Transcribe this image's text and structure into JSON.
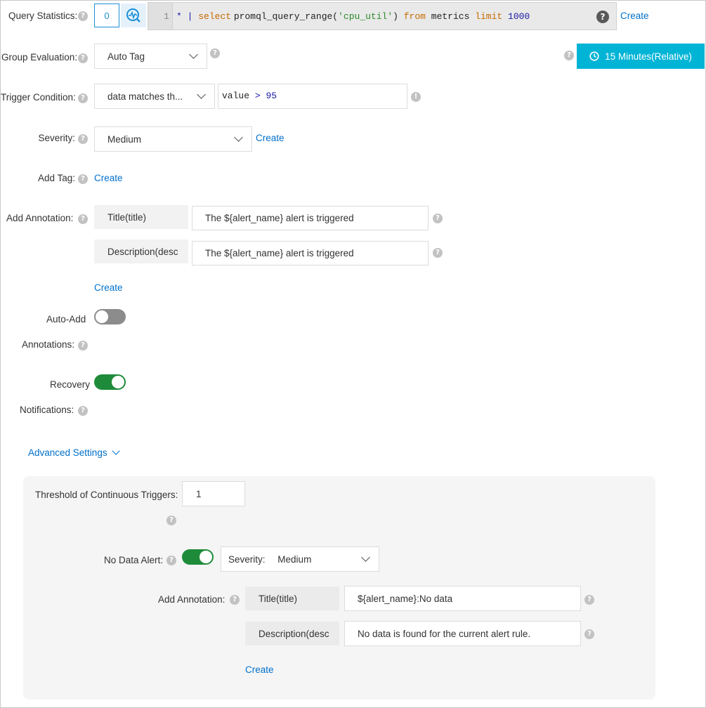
{
  "query": {
    "label": "Query Statistics:",
    "count": "0",
    "line_number": "1",
    "code": {
      "star": "*",
      "pipe": "|",
      "kw_select": "select",
      "func": "promql_query_range(",
      "arg": "'cpu_util'",
      "close": ")",
      "kw_from": "from",
      "table": "metrics",
      "kw_limit": "limit",
      "limit_value": "1000"
    },
    "create": "Create"
  },
  "group_eval": {
    "label": "Group Evaluation:",
    "value": "Auto Tag"
  },
  "time_range": {
    "label": "15 Minutes(Relative)"
  },
  "trigger": {
    "label": "Trigger Condition:",
    "select": "data matches th...",
    "expr_var": "value",
    "expr_op": ">",
    "expr_num": "95"
  },
  "severity": {
    "label": "Severity:",
    "value": "Medium",
    "create": "Create"
  },
  "add_tag": {
    "label": "Add Tag:",
    "create": "Create"
  },
  "annotation": {
    "label": "Add Annotation:",
    "rows": [
      {
        "key": "Title(title)",
        "value": "The ${alert_name} alert is triggered"
      },
      {
        "key": "Description(desc",
        "value": "The ${alert_name} alert is triggered"
      }
    ],
    "create": "Create"
  },
  "auto_add": {
    "line1": "Auto-Add",
    "line2": "Annotations:"
  },
  "recovery": {
    "line1": "Recovery",
    "line2": "Notifications:"
  },
  "advanced": {
    "label": "Advanced Settings",
    "threshold_label": "Threshold of Continuous Triggers:",
    "threshold_value": "1",
    "no_data_label": "No Data Alert:",
    "severity_label": "Severity:",
    "severity_value": "Medium",
    "annotation_label": "Add Annotation:",
    "rows": [
      {
        "key": "Title(title)",
        "value": "${alert_name}:No data"
      },
      {
        "key": "Description(desc",
        "value": "No data is found for the current alert rule."
      }
    ],
    "create": "Create"
  },
  "colors": {
    "accent": "#00b4d6",
    "link": "#0070cc",
    "toggle_on": "#1e8b3a"
  }
}
